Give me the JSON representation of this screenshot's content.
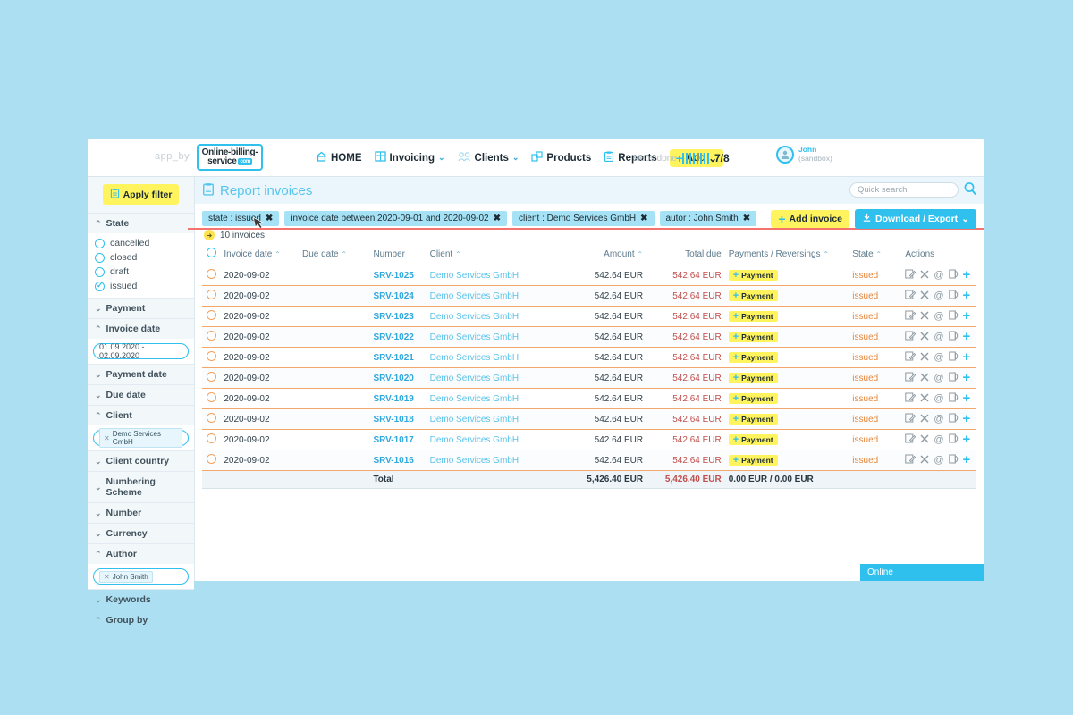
{
  "topbar": {
    "app_by": "app_by",
    "logo": {
      "line1": "Online-billing-",
      "line2": "service",
      "dotcom": "com"
    },
    "nav": [
      {
        "label": "HOME",
        "icon": "home-icon",
        "caret": ""
      },
      {
        "label": "Invoicing",
        "icon": "invoicing-icon",
        "caret": "⌄"
      },
      {
        "label": "Clients",
        "icon": "clients-icon",
        "caret": "⌄"
      },
      {
        "label": "Products",
        "icon": "products-icon",
        "caret": ""
      },
      {
        "label": "Reports",
        "icon": "reports-icon",
        "caret": ""
      }
    ],
    "add_button": {
      "label": "Add",
      "caret": "⌄"
    },
    "steps": {
      "label": "steps done",
      "bars": 8,
      "fraction": "7/8"
    },
    "user": {
      "name": "John",
      "mode": "(sandbox)"
    }
  },
  "sidebar": {
    "apply_filter": "Apply filter",
    "sections": [
      {
        "label": "State",
        "expanded": true,
        "options": [
          {
            "label": "cancelled",
            "checked": false
          },
          {
            "label": "closed",
            "checked": false
          },
          {
            "label": "draft",
            "checked": false
          },
          {
            "label": "issued",
            "checked": true
          }
        ]
      },
      {
        "label": "Payment",
        "expanded": false
      },
      {
        "label": "Invoice date",
        "expanded": true,
        "field_value": "01.09.2020 - 02.09.2020"
      },
      {
        "label": "Payment date",
        "expanded": false
      },
      {
        "label": "Due date",
        "expanded": false
      },
      {
        "label": "Client",
        "expanded": true,
        "tag": "Demo Services GmbH"
      },
      {
        "label": "Client country",
        "expanded": false
      },
      {
        "label": "Numbering Scheme",
        "expanded": false
      },
      {
        "label": "Number",
        "expanded": false
      },
      {
        "label": "Currency",
        "expanded": false
      },
      {
        "label": "Author",
        "expanded": true,
        "tag": "John Smith"
      },
      {
        "label": "Keywords",
        "expanded": false
      },
      {
        "label": "Group by",
        "expanded": true
      }
    ]
  },
  "page": {
    "title": "Report invoices",
    "search_placeholder": "Quick search",
    "chips": [
      "state : issued",
      "invoice date between 2020-09-01 and 2020-09-02",
      "client : Demo Services GmbH",
      "autor : John Smith"
    ],
    "count_label": "10 invoices",
    "add_invoice": "Add invoice",
    "download_export": "Download / Export",
    "download_caret": "⌄",
    "online_badge": "Online"
  },
  "table": {
    "headers": [
      {
        "label": "",
        "sort": ""
      },
      {
        "label": "Invoice date",
        "sort": "⌃"
      },
      {
        "label": "Due date",
        "sort": "⌃"
      },
      {
        "label": "Number",
        "sort": ""
      },
      {
        "label": "Client",
        "sort": "⌃"
      },
      {
        "label": "Amount",
        "sort": "⌃"
      },
      {
        "label": "Total due",
        "sort": ""
      },
      {
        "label": "Payments / Reversings",
        "sort": "⌃"
      },
      {
        "label": "State",
        "sort": "⌃"
      },
      {
        "label": "Actions",
        "sort": ""
      }
    ],
    "rows": [
      {
        "invoice_date": "2020-09-02",
        "due_date": "",
        "number": "SRV-1025",
        "client": "Demo Services GmbH",
        "amount": "542.64 EUR",
        "total_due": "542.64 EUR",
        "payment": "Payment",
        "state": "issued"
      },
      {
        "invoice_date": "2020-09-02",
        "due_date": "",
        "number": "SRV-1024",
        "client": "Demo Services GmbH",
        "amount": "542.64 EUR",
        "total_due": "542.64 EUR",
        "payment": "Payment",
        "state": "issued"
      },
      {
        "invoice_date": "2020-09-02",
        "due_date": "",
        "number": "SRV-1023",
        "client": "Demo Services GmbH",
        "amount": "542.64 EUR",
        "total_due": "542.64 EUR",
        "payment": "Payment",
        "state": "issued"
      },
      {
        "invoice_date": "2020-09-02",
        "due_date": "",
        "number": "SRV-1022",
        "client": "Demo Services GmbH",
        "amount": "542.64 EUR",
        "total_due": "542.64 EUR",
        "payment": "Payment",
        "state": "issued"
      },
      {
        "invoice_date": "2020-09-02",
        "due_date": "",
        "number": "SRV-1021",
        "client": "Demo Services GmbH",
        "amount": "542.64 EUR",
        "total_due": "542.64 EUR",
        "payment": "Payment",
        "state": "issued"
      },
      {
        "invoice_date": "2020-09-02",
        "due_date": "",
        "number": "SRV-1020",
        "client": "Demo Services GmbH",
        "amount": "542.64 EUR",
        "total_due": "542.64 EUR",
        "payment": "Payment",
        "state": "issued"
      },
      {
        "invoice_date": "2020-09-02",
        "due_date": "",
        "number": "SRV-1019",
        "client": "Demo Services GmbH",
        "amount": "542.64 EUR",
        "total_due": "542.64 EUR",
        "payment": "Payment",
        "state": "issued"
      },
      {
        "invoice_date": "2020-09-02",
        "due_date": "",
        "number": "SRV-1018",
        "client": "Demo Services GmbH",
        "amount": "542.64 EUR",
        "total_due": "542.64 EUR",
        "payment": "Payment",
        "state": "issued"
      },
      {
        "invoice_date": "2020-09-02",
        "due_date": "",
        "number": "SRV-1017",
        "client": "Demo Services GmbH",
        "amount": "542.64 EUR",
        "total_due": "542.64 EUR",
        "payment": "Payment",
        "state": "issued"
      },
      {
        "invoice_date": "2020-09-02",
        "due_date": "",
        "number": "SRV-1016",
        "client": "Demo Services GmbH",
        "amount": "542.64 EUR",
        "total_due": "542.64 EUR",
        "payment": "Payment",
        "state": "issued"
      }
    ],
    "total": {
      "label": "Total",
      "amount": "5,426.40 EUR",
      "total_due": "5,426.40 EUR",
      "payments": "0.00 EUR / 0.00 EUR"
    }
  },
  "colors": {
    "page_background": "#ACDFF2",
    "accent_blue": "#2FC0EE",
    "accent_yellow": "#FFF45E",
    "state_orange": "#E8873A",
    "due_red": "#C0504D",
    "chip_blue": "#A6E2F5",
    "red_line": "#F4736E"
  }
}
